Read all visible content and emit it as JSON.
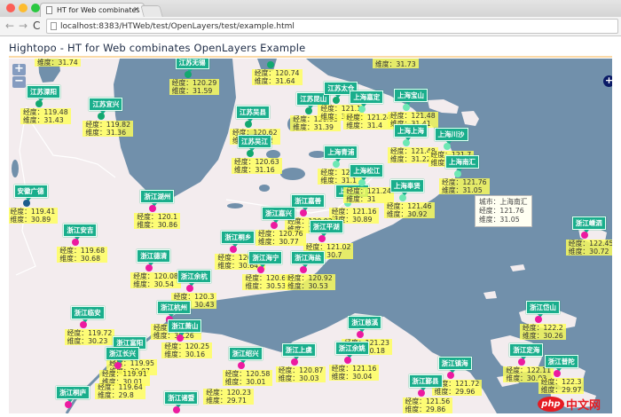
{
  "browser": {
    "tab_title": "HT for Web combinates Op",
    "url": "localhost:8383/HTWeb/test/OpenLayers/test/example.html"
  },
  "page": {
    "title": "Hightopo - HT for Web combinates OpenLayers Example"
  },
  "map": {
    "zoom_in": "+",
    "zoom_out": "−",
    "layer_switcher": "+",
    "labels": {
      "lon": "经度：",
      "lat": "维度：",
      "city": "城市："
    },
    "colors": {
      "land": "#f3ecee",
      "water": "#7190ab",
      "label_bg": "#1aae8c",
      "info_bg": "#ffff5a",
      "江苏": "#12a870",
      "上海": "#6ee8b4",
      "浙江": "#ec1aa0",
      "安徽": "#1d5c8c"
    },
    "cities": [
      {
        "name": "",
        "province": "江苏",
        "lon": "",
        "lat": "31.74"
      },
      {
        "name": "",
        "province": "上海",
        "lon": "",
        "lat": "31.73"
      },
      {
        "name": "江苏溧阳",
        "province": "江苏",
        "lon": "119.48",
        "lat": "31.43"
      },
      {
        "name": "江苏宜兴",
        "province": "江苏",
        "lon": "119.82",
        "lat": "31.36"
      },
      {
        "name": "江苏无锡",
        "province": "江苏",
        "lon": "120.29",
        "lat": "31.59"
      },
      {
        "name": "",
        "province": "江苏",
        "lon": "120.74",
        "lat": "31.64"
      },
      {
        "name": "江苏吴县",
        "province": "江苏",
        "lon": "120.62",
        "lat": "31.32"
      },
      {
        "name": "江苏昆山",
        "province": "江苏",
        "lon": "120.95",
        "lat": "31.39"
      },
      {
        "name": "江苏太仓",
        "province": "江苏",
        "lon": "121.1",
        "lat": "31.45"
      },
      {
        "name": "上海嘉定",
        "province": "上海",
        "lon": "121.24",
        "lat": "31.4"
      },
      {
        "name": "上海宝山",
        "province": "上海",
        "lon": "121.48",
        "lat": "31.41"
      },
      {
        "name": "江苏吴江",
        "province": "江苏",
        "lon": "120.63",
        "lat": "31.16"
      },
      {
        "name": "上海上海",
        "province": "上海",
        "lon": "121.48",
        "lat": "31.22"
      },
      {
        "name": "上海川沙",
        "province": "上海",
        "lon": "121.7",
        "lat": "31.2"
      },
      {
        "name": "上海青浦",
        "province": "上海",
        "lon": "121.1",
        "lat": "31.1"
      },
      {
        "name": "上海金山",
        "province": "上海",
        "lon": "121.16",
        "lat": "30.89"
      },
      {
        "name": "上海松江",
        "province": "上海",
        "lon": "121.24",
        "lat": "31"
      },
      {
        "name": "上海南汇",
        "province": "上海",
        "lon": "121.76",
        "lat": "31.05"
      },
      {
        "name": "上海奉贤",
        "province": "上海",
        "lon": "121.46",
        "lat": "30.92"
      },
      {
        "name": "安徽广德",
        "province": "安徽",
        "lon": "119.41",
        "lat": "30.89"
      },
      {
        "name": "浙江湖州",
        "province": "浙江",
        "lon": "120.1",
        "lat": "30.86"
      },
      {
        "name": "浙江嘉善",
        "province": "浙江",
        "lon": "120.92",
        "lat": "30.84"
      },
      {
        "name": "浙江嘉兴",
        "province": "浙江",
        "lon": "120.76",
        "lat": "30.77"
      },
      {
        "name": "浙江平湖",
        "province": "浙江",
        "lon": "121.02",
        "lat": "30.7"
      },
      {
        "name": "浙江安吉",
        "province": "浙江",
        "lon": "119.68",
        "lat": "30.68"
      },
      {
        "name": "浙江桐乡",
        "province": "浙江",
        "lon": "120.54",
        "lat": "30.64"
      },
      {
        "name": "浙江德清",
        "province": "浙江",
        "lon": "120.08",
        "lat": "30.54"
      },
      {
        "name": "浙江海宁",
        "province": "浙江",
        "lon": "120.69",
        "lat": "30.53"
      },
      {
        "name": "浙江海盐",
        "province": "浙江",
        "lon": "120.92",
        "lat": "30.53"
      },
      {
        "name": "浙江余杭",
        "province": "浙江",
        "lon": "120.3",
        "lat": "30.43"
      },
      {
        "name": "浙江嵊泗",
        "province": "浙江",
        "lon": "122.45",
        "lat": "30.72"
      },
      {
        "name": "浙江杭州",
        "province": "浙江",
        "lon": "120.19",
        "lat": "30.26"
      },
      {
        "name": "浙江临安",
        "province": "浙江",
        "lon": "119.72",
        "lat": "30.23"
      },
      {
        "name": "浙江萧山",
        "province": "浙江",
        "lon": "120.25",
        "lat": "30.16"
      },
      {
        "name": "浙江岱山",
        "province": "浙江",
        "lon": "122.2",
        "lat": "30.26"
      },
      {
        "name": "浙江慈溪",
        "province": "浙江",
        "lon": "121.23",
        "lat": "30.18"
      },
      {
        "name": "浙江富阳",
        "province": "浙江",
        "lon": "119.95",
        "lat": "30.07"
      },
      {
        "name": "浙江长兴",
        "province": "浙江",
        "lon": "119.91",
        "lat": "30.01"
      },
      {
        "name": "浙江绍兴",
        "province": "浙江",
        "lon": "120.58",
        "lat": "30.01"
      },
      {
        "name": "浙江上虞",
        "province": "浙江",
        "lon": "120.87",
        "lat": "30.03"
      },
      {
        "name": "浙江余姚",
        "province": "浙江",
        "lon": "121.16",
        "lat": "30.04"
      },
      {
        "name": "浙江定海",
        "province": "浙江",
        "lon": "122.11",
        "lat": "30.03"
      },
      {
        "name": "浙江镇海",
        "province": "浙江",
        "lon": "121.72",
        "lat": "29.96"
      },
      {
        "name": "浙江普陀",
        "province": "浙江",
        "lon": "122.3",
        "lat": "29.97"
      },
      {
        "name": "浙江鄞县",
        "province": "浙江",
        "lon": "121.56",
        "lat": "29.86"
      },
      {
        "name": "浙江桐庐",
        "province": "浙江",
        "lon": "119.64",
        "lat": "29.8"
      },
      {
        "name": "浙江诸暨",
        "province": "浙江",
        "lon": "120.23",
        "lat": "29.71"
      }
    ],
    "tooltip": {
      "city": "上海南汇",
      "lon": "121.76",
      "lat": "31.05"
    }
  },
  "watermark": {
    "logo": "php",
    "text": "中文网"
  }
}
